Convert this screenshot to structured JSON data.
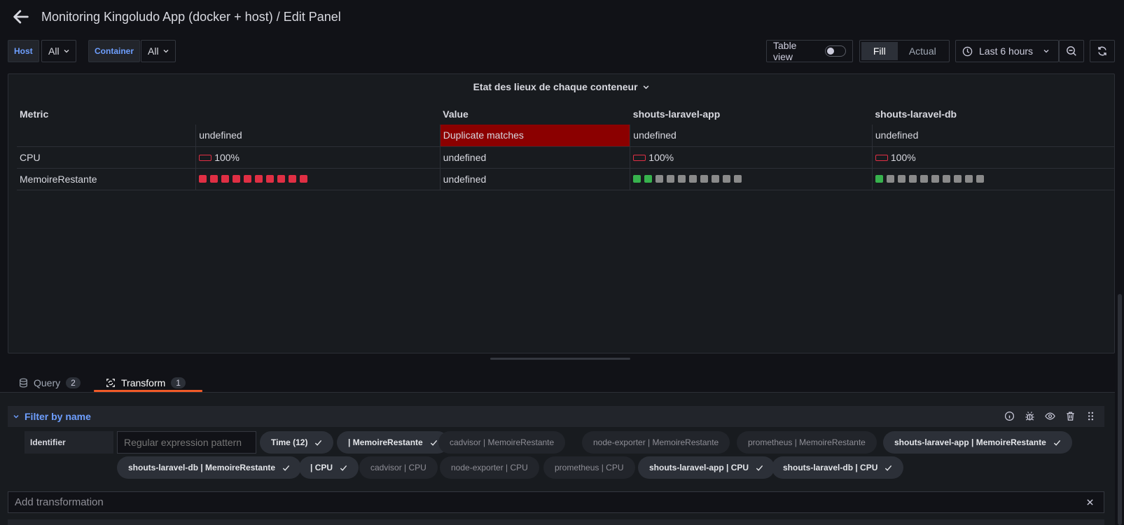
{
  "header": {
    "title": "Monitoring Kingoludo App (docker + host) / Edit Panel"
  },
  "variables": [
    {
      "label": "Host",
      "value": "All"
    },
    {
      "label": "Container",
      "value": "All"
    }
  ],
  "toolbar": {
    "table_view_label": "Table view",
    "table_view_enabled": false,
    "fill_label": "Fill",
    "actual_label": "Actual",
    "time_range": "Last 6 hours"
  },
  "panel": {
    "title": "Etat des lieux de chaque conteneur",
    "columns": [
      "Metric",
      "",
      "Value",
      "shouts-laravel-app",
      "shouts-laravel-db"
    ],
    "rows": [
      {
        "metric": "",
        "c1": "undefined",
        "value": "Duplicate matches",
        "app": "undefined",
        "db": "undefined"
      },
      {
        "metric": "CPU",
        "c1": "100%",
        "value": "undefined",
        "app": "100%",
        "db": "100%"
      },
      {
        "metric": "MemoireRestante",
        "c1_leds": "10 red",
        "value": "undefined",
        "app_leds": "2 green, 8 gray",
        "db_leds": "1 green, 9 gray"
      }
    ],
    "colors": {
      "duplicate_bg": "#8b0000",
      "led_red": "#e02f44",
      "led_green": "#37b24d",
      "led_gray": "#8a8a8a"
    }
  },
  "tabs": [
    {
      "label": "Query",
      "count": "2",
      "icon": "database-icon"
    },
    {
      "label": "Transform",
      "count": "1",
      "icon": "transform-icon",
      "active": true
    }
  ],
  "transformation": {
    "name": "Filter by name",
    "identifier_label": "Identifier",
    "regex_placeholder": "Regular expression pattern",
    "chips": [
      {
        "label": "Time (12)",
        "selected": true
      },
      {
        "label": "| MemoireRestante",
        "selected": true
      },
      {
        "label": "cadvisor | MemoireRestante",
        "selected": false
      },
      {
        "label": "node-exporter | MemoireRestante",
        "selected": false
      },
      {
        "label": "prometheus | MemoireRestante",
        "selected": false
      },
      {
        "label": "shouts-laravel-app | MemoireRestante",
        "selected": true
      },
      {
        "label": "shouts-laravel-db | MemoireRestante",
        "selected": true
      },
      {
        "label": "| CPU",
        "selected": true
      },
      {
        "label": "cadvisor | CPU",
        "selected": false
      },
      {
        "label": "node-exporter | CPU",
        "selected": false
      },
      {
        "label": "prometheus | CPU",
        "selected": false
      },
      {
        "label": "shouts-laravel-app | CPU",
        "selected": true
      },
      {
        "label": "shouts-laravel-db | CPU",
        "selected": true
      }
    ]
  },
  "add_transformation": {
    "placeholder": "Add transformation"
  },
  "theme": {
    "accent": "#6e9fff",
    "tab_active_underline": "#f05a28",
    "background": "#111217"
  }
}
